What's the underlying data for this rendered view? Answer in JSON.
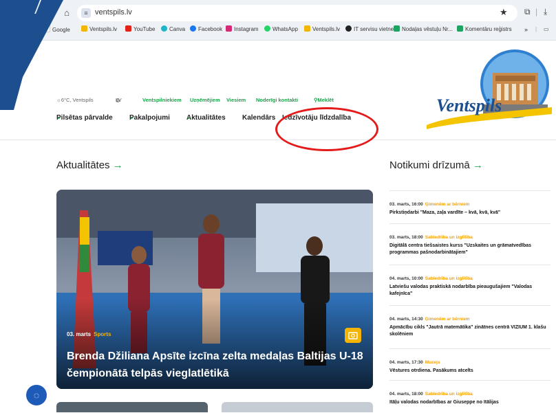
{
  "browser": {
    "url": "ventspils.lv",
    "bookmarks": [
      "Google",
      "Ventspils.lv",
      "YouTube",
      "Canva",
      "Facebook",
      "Instagram",
      "WhatsApp",
      "Ventspils.lv",
      "IT servisu vietne",
      "Nodaļas vēstuļu Nr...",
      "Komentāru reģistrs"
    ],
    "colors": {
      "youtube": "#e62117",
      "canva": "#1fb5c9",
      "facebook": "#1877f2",
      "instagram": "#d62976",
      "whatsapp": "#25d366",
      "green": "#1da462"
    }
  },
  "header": {
    "weather": "6°C, Ventspils",
    "lang": "LV",
    "util_links": [
      "Ventspilniekiem",
      "Uzņēmējiem",
      "Viesiem",
      "Noderīgi kontakti"
    ],
    "search_label": "Meklēt",
    "nav": [
      "Pilsētas pārvalde",
      "Pakalpojumi",
      "Aktualitātes",
      "Kalendārs",
      "Iedzīvotāju līdzdalība"
    ],
    "logo_text": "Ventspils"
  },
  "news": {
    "title": "Aktualitātes",
    "arrow": "→",
    "featured": {
      "date": "03. marts",
      "category": "Sports",
      "title": "Brenda Džiliana Apsīte izcīna zelta medaļas Baltijas U-18 čempionātā telpās vieglatlētikā"
    }
  },
  "events": {
    "title": "Notikumi drīzumā",
    "arrow": "→",
    "items": [
      {
        "date": "03. marts, 16:00",
        "category": "Ģimenēm ar bērniem",
        "title": "Pirkstiņdarbi \"Maza, zaļa vardīte – kvā, kvā, kvā\""
      },
      {
        "date": "03. marts, 18:00",
        "category": "Sabiedrība un izglītība",
        "title": "Digitālā centra tiešsaistes kurss \"Uzskaites un grāmatvedības programmas pašnodarbinātajiem\""
      },
      {
        "date": "04. marts, 10:00",
        "category": "Sabiedrība un izglītība",
        "title": "Latviešu valodas praktiskā nodarbība pieaugušajiem \"Valodas kafejnīca\""
      },
      {
        "date": "04. marts, 14:30",
        "category": "Ģimenēm ar bērniem",
        "title": "Apmācību cikls \"Jautrā matemātika\" zinātnes centrā VIZIUM 1. klašu skolēniem"
      },
      {
        "date": "04. marts, 17:30",
        "category": "Muzejs",
        "title": "Vēstures otrdiena. Pasākums atcelts"
      },
      {
        "date": "04. marts, 18:00",
        "category": "Sabiedrība un izglītība",
        "title": "Itāļu valodas nodarbības ar Giuseppe no Itālijas"
      }
    ]
  },
  "colors": {
    "accent_green": "#1aa34a",
    "category_orange": "#f5a000",
    "corner_blue": "#1d4f8f",
    "annotation_red": "#e31b1b"
  }
}
